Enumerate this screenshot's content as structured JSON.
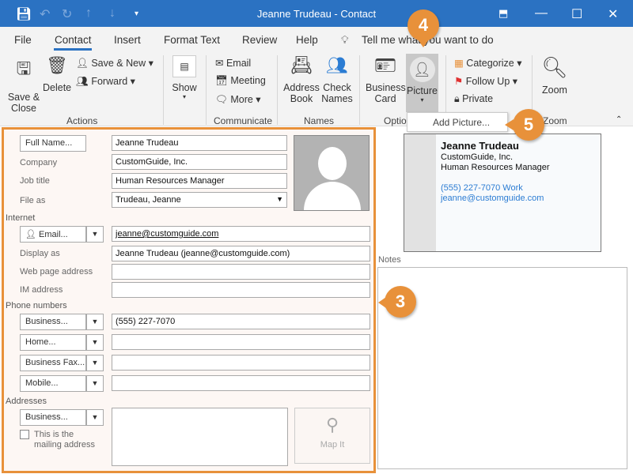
{
  "window": {
    "title": "Jeanne Trudeau  -  Contact"
  },
  "menu": [
    "File",
    "Contact",
    "Insert",
    "Format Text",
    "Review",
    "Help"
  ],
  "tell_me": "Tell me what you want to do",
  "ribbon": {
    "save_close": "Save &\nClose",
    "delete": "Delete",
    "save_new": "Save & New",
    "forward": "Forward",
    "show": "Show",
    "email": "Email",
    "meeting": "Meeting",
    "more": "More",
    "address_book": "Address\nBook",
    "check_names": "Check\nNames",
    "business_card": "Business\nCard",
    "picture": "Picture",
    "categorize": "Categorize",
    "follow_up": "Follow Up",
    "private": "Private",
    "zoom": "Zoom",
    "groups": {
      "actions": "Actions",
      "communicate": "Communicate",
      "names": "Names",
      "options": "Optio",
      "zoom": "Zoom"
    }
  },
  "dropdown": {
    "add_picture": "Add Picture..."
  },
  "callouts": [
    "3",
    "4",
    "5"
  ],
  "form": {
    "full_name_btn": "Full Name...",
    "full_name": "Jeanne Trudeau",
    "company_label": "Company",
    "company": "CustomGuide, Inc.",
    "job_title_label": "Job title",
    "job_title": "Human Resources Manager",
    "file_as_label": "File as",
    "file_as": "Trudeau, Jeanne",
    "internet_section": "Internet",
    "email_btn": "Email...",
    "email": "jeanne@customguide.com",
    "display_as_label": "Display as",
    "display_as": "Jeanne Trudeau (jeanne@customguide.com)",
    "web_label": "Web page address",
    "web": "",
    "im_label": "IM address",
    "im": "",
    "phone_section": "Phone numbers",
    "phones": [
      {
        "label": "Business...",
        "value": "(555) 227-7070"
      },
      {
        "label": "Home...",
        "value": ""
      },
      {
        "label": "Business Fax...",
        "value": ""
      },
      {
        "label": "Mobile...",
        "value": ""
      }
    ],
    "addresses_section": "Addresses",
    "address_btn": "Business...",
    "address": "",
    "mailing_checkbox": "This is the\nmailing address",
    "mailing_checked": false,
    "map_it": "Map It"
  },
  "card": {
    "name": "Jeanne Trudeau",
    "company": "CustomGuide, Inc.",
    "title": "Human Resources Manager",
    "phone": "(555) 227-7070",
    "phone_type": "Work",
    "email": "jeanne@customguide.com"
  },
  "notes": {
    "label": "Notes",
    "value": ""
  },
  "colors": {
    "titlebar": "#2b72c2",
    "accent": "#e8913a",
    "link": "#2b7cd3"
  }
}
